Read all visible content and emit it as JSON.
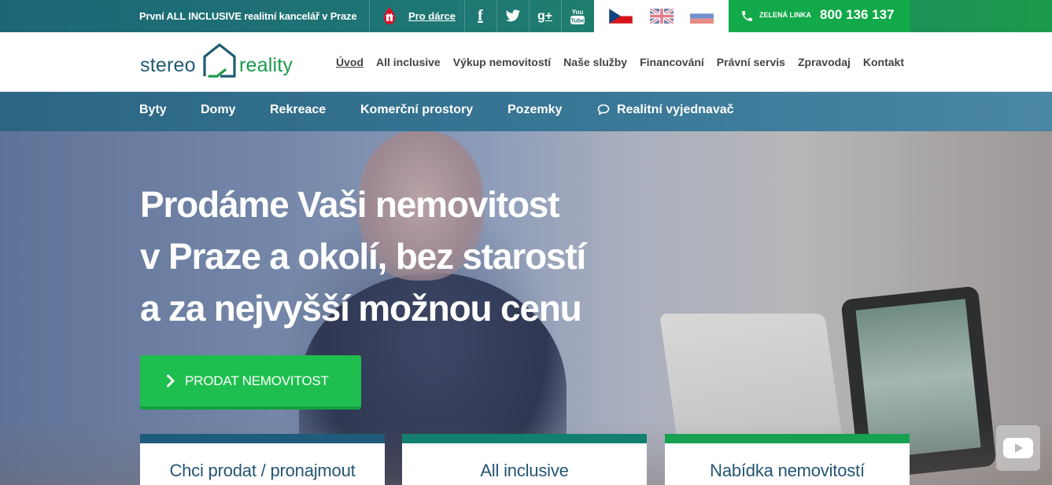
{
  "topbar": {
    "tagline": "První ALL INCLUSIVE realitní kancelář v Praze",
    "donor_link": "Pro dárce",
    "social": [
      {
        "icon": "facebook-icon",
        "glyph": "f"
      },
      {
        "icon": "twitter-icon",
        "glyph": ""
      },
      {
        "icon": "google-plus-icon",
        "glyph": "g+"
      },
      {
        "icon": "youtube-icon",
        "glyph": "You Tube"
      }
    ],
    "languages": [
      "cz-flag-icon",
      "en-flag-icon",
      "ru-flag-icon"
    ],
    "hotline_label": "ZELENÁ LINKA",
    "hotline_number": "800 136 137"
  },
  "colors": {
    "brand_blue": "#1e5b74",
    "brand_green": "#1b9a4d",
    "cta_green": "#1fbf4f",
    "card_bar_1": "#1f5c7b",
    "card_bar_2": "#137f70",
    "card_bar_3": "#15a150"
  },
  "logo": {
    "word1": "stereo",
    "word2": "reality"
  },
  "mainnav": {
    "items": [
      {
        "label": "Úvod",
        "active": true
      },
      {
        "label": "All inclusive",
        "active": false
      },
      {
        "label": "Výkup nemovitostí",
        "active": false
      },
      {
        "label": "Naše služby",
        "active": false
      },
      {
        "label": "Financování",
        "active": false
      },
      {
        "label": "Právní servis",
        "active": false
      },
      {
        "label": "Zpravodaj",
        "active": false
      },
      {
        "label": "Kontakt",
        "active": false
      }
    ]
  },
  "catbar": {
    "items": [
      "Byty",
      "Domy",
      "Rekreace",
      "Komerční prostory",
      "Pozemky"
    ],
    "negotiator": "Realitní vyjednavač"
  },
  "hero": {
    "headline_lines": [
      "Prodáme Vaši nemovitost",
      "v Praze a okolí, bez starostí",
      "a za nejvyšší možnou cenu"
    ],
    "cta_label": "PRODAT NEMOVITOST"
  },
  "cards": [
    {
      "title": "Chci prodat / pronajmout"
    },
    {
      "title": "All inclusive"
    },
    {
      "title": "Nabídka nemovitostí"
    }
  ]
}
